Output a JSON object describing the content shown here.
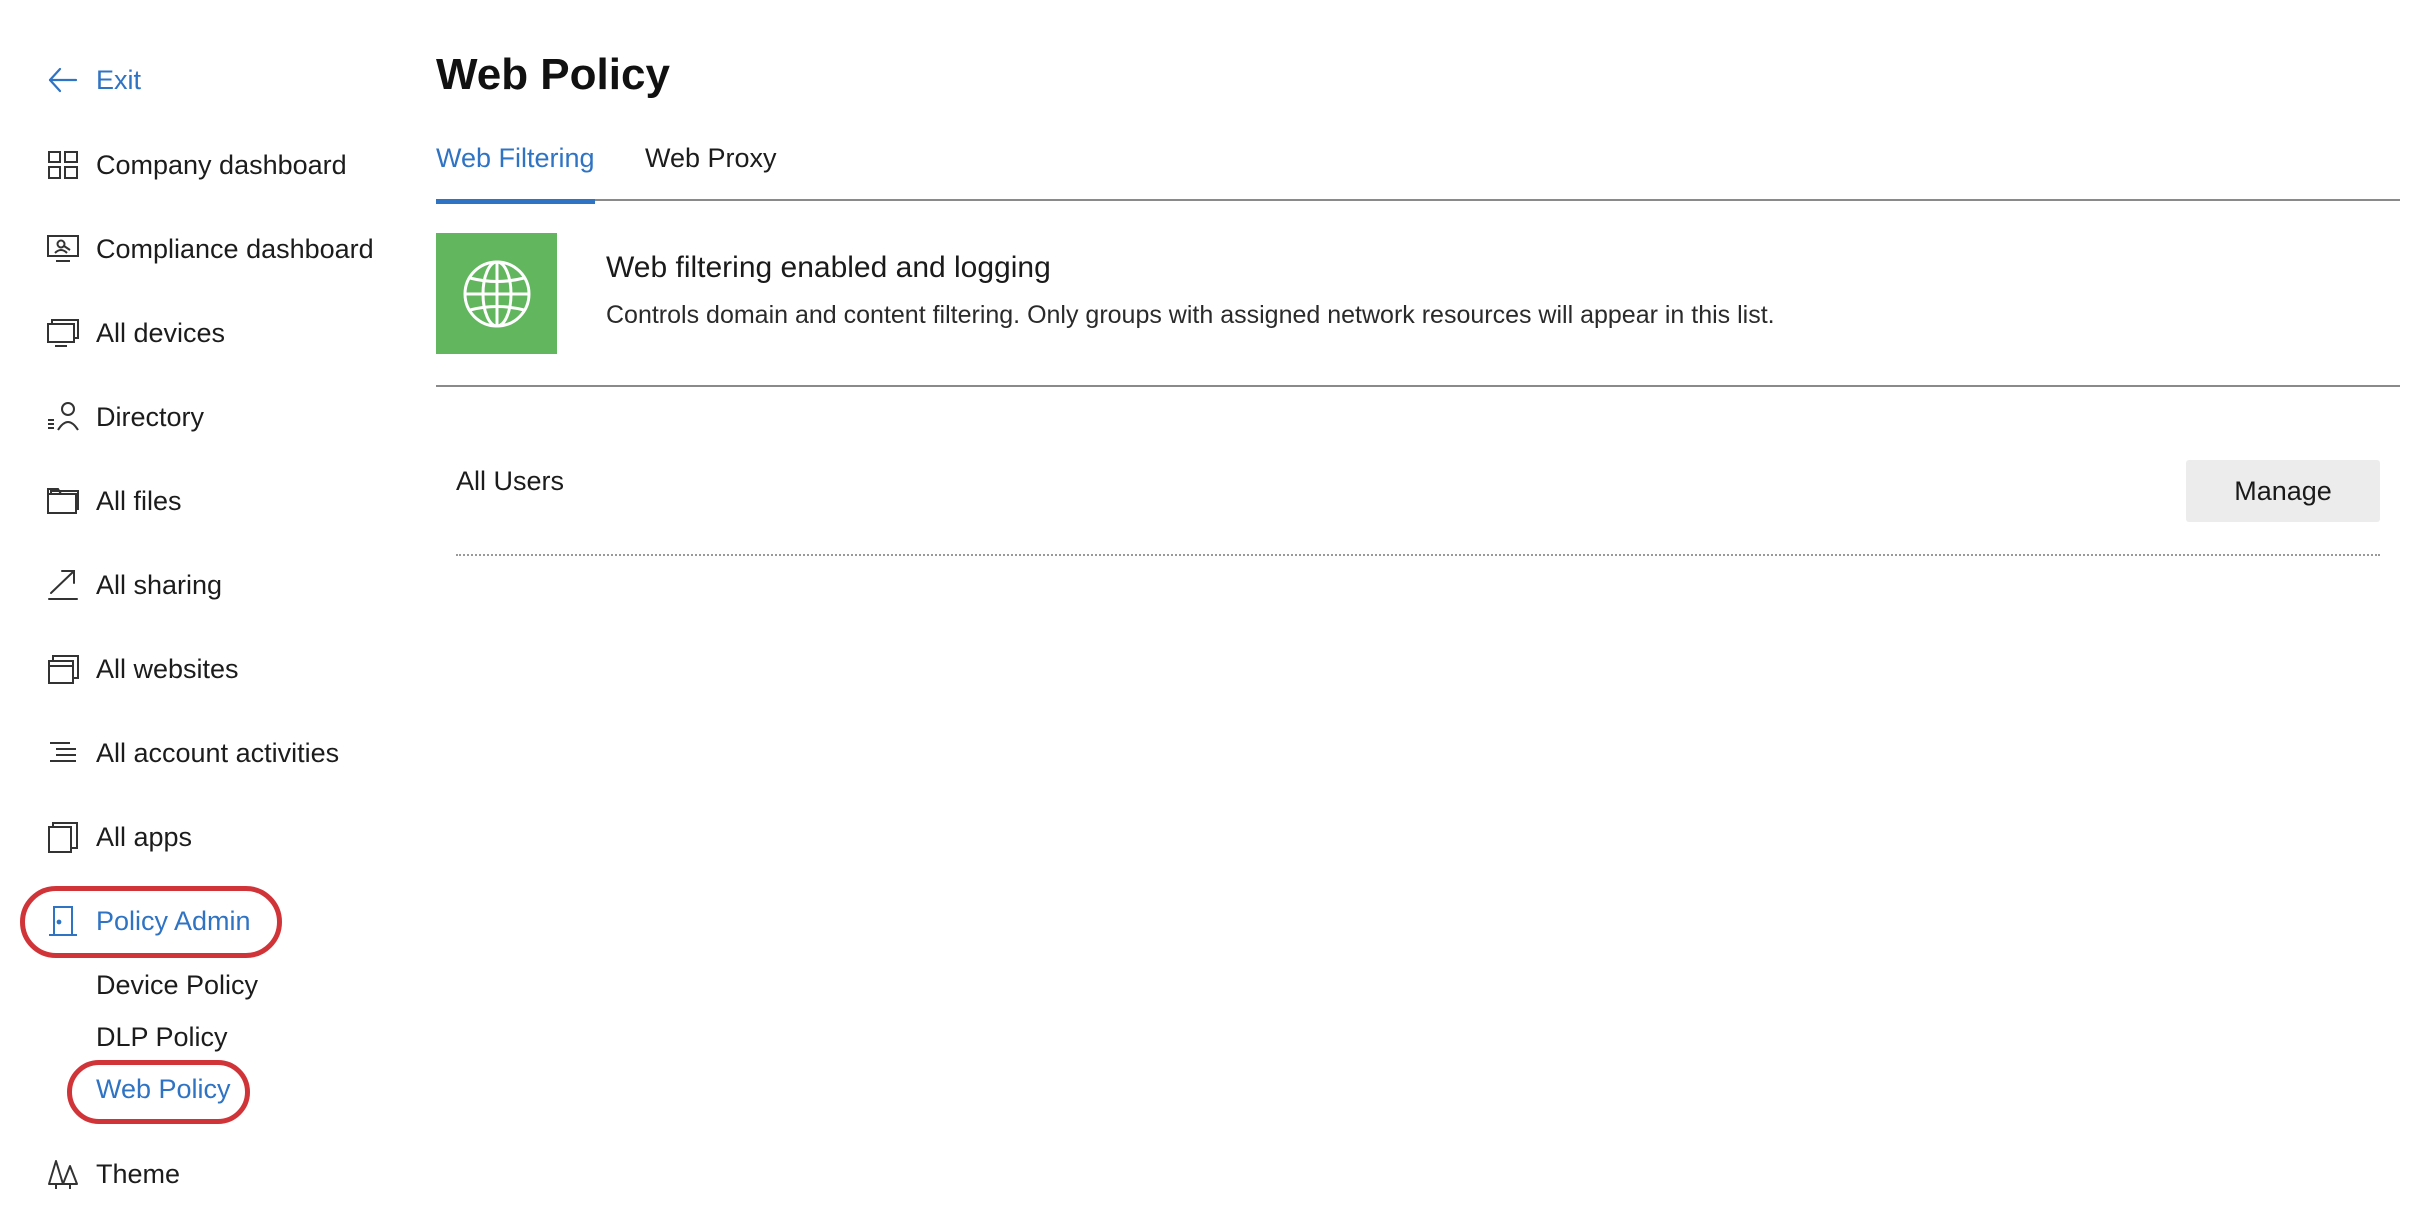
{
  "colors": {
    "accent": "#2f73c4",
    "highlight": "#d13438",
    "feature_icon_bg": "#62b65e",
    "button_bg": "#ececec"
  },
  "sidebar": {
    "exit_label": "Exit",
    "items": [
      {
        "label": "Company dashboard",
        "icon": "dashboard-grid-icon"
      },
      {
        "label": "Compliance dashboard",
        "icon": "monitor-user-icon"
      },
      {
        "label": "All devices",
        "icon": "devices-icon"
      },
      {
        "label": "Directory",
        "icon": "person-list-icon"
      },
      {
        "label": "All files",
        "icon": "folder-icon"
      },
      {
        "label": "All sharing",
        "icon": "share-arrow-icon"
      },
      {
        "label": "All websites",
        "icon": "browser-windows-icon"
      },
      {
        "label": "All account activities",
        "icon": "activity-list-icon"
      },
      {
        "label": "All apps",
        "icon": "apps-icon"
      },
      {
        "label": "Policy Admin",
        "icon": "door-icon"
      }
    ],
    "policy_sub_items": [
      "Device Policy",
      "DLP Policy",
      "Web Policy"
    ],
    "theme_label": "Theme"
  },
  "main": {
    "title": "Web Policy",
    "tabs": [
      "Web Filtering",
      "Web Proxy"
    ],
    "active_tab": "Web Filtering",
    "feature": {
      "icon": "globe-icon",
      "title": "Web filtering enabled and logging",
      "description": "Controls domain and content filtering. Only groups with assigned network resources will appear in this list."
    },
    "groups": [
      {
        "name": "All Users",
        "action_label": "Manage"
      }
    ]
  }
}
